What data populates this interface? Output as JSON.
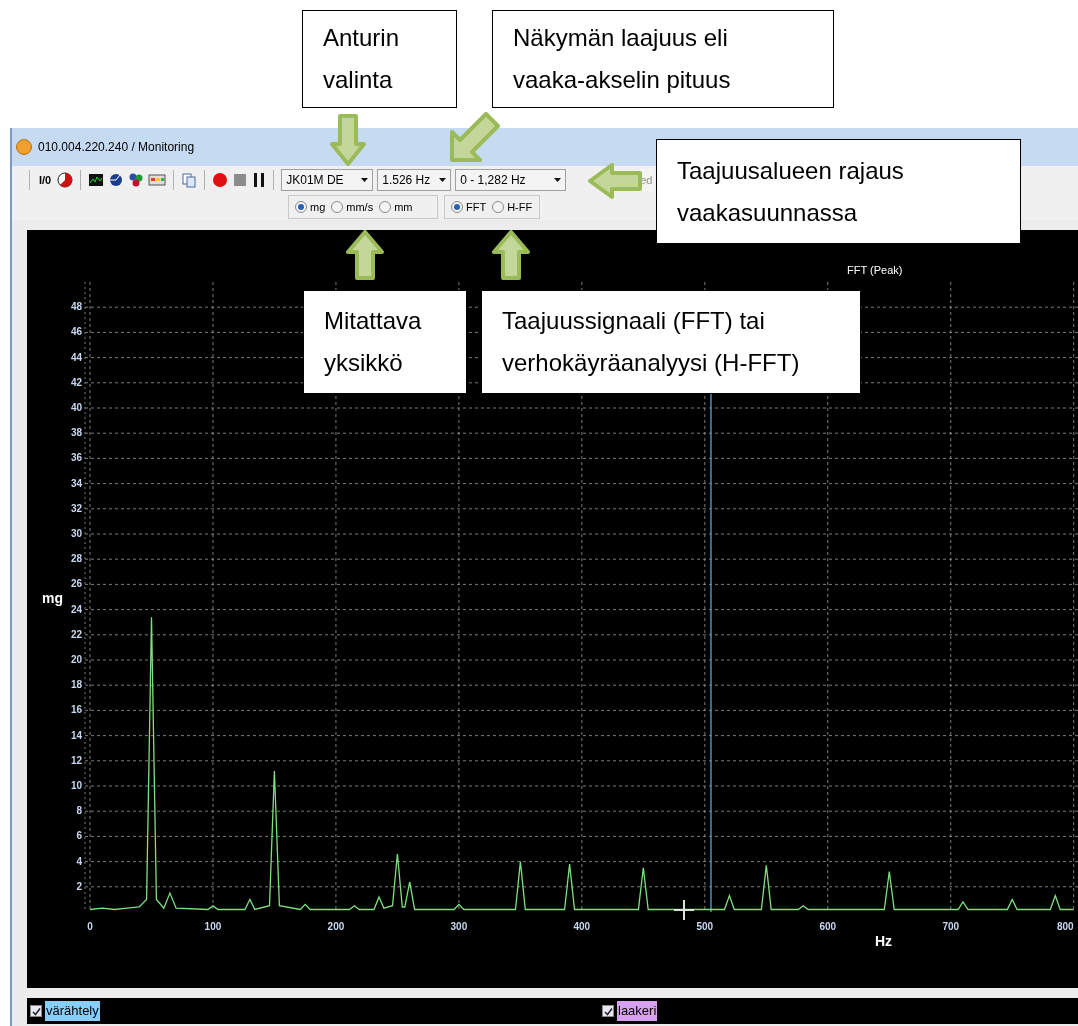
{
  "window": {
    "title": "010.004.220.240 / Monitoring"
  },
  "toolbar": {
    "io_button": "I/0",
    "sensor_dropdown": "JK01M DE",
    "resolution_dropdown": "1.526 Hz",
    "range_dropdown": "0 - 1,282 Hz",
    "partial_button": "ed"
  },
  "unit_options": [
    {
      "label": "mg",
      "selected": true
    },
    {
      "label": "mm/s",
      "selected": false
    },
    {
      "label": "mm",
      "selected": false
    }
  ],
  "mode_options": [
    {
      "label": "FFT",
      "selected": true
    },
    {
      "label": "H-FF",
      "selected": false
    }
  ],
  "chart": {
    "chart_data": {
      "type": "line",
      "title": "FFT (Peak)",
      "xlabel": "Hz",
      "ylabel": "mg",
      "xlim": [
        0,
        800
      ],
      "ylim": [
        0,
        50
      ],
      "grid": true,
      "xticks": [
        0,
        100,
        200,
        300,
        400,
        500,
        600,
        700,
        800
      ],
      "yticks": [
        2,
        4,
        6,
        8,
        10,
        12,
        14,
        16,
        18,
        20,
        22,
        24,
        26,
        28,
        30,
        32,
        34,
        36,
        38,
        40,
        42,
        44,
        46,
        48
      ],
      "x": [
        0,
        10,
        20,
        30,
        40,
        46,
        50,
        54,
        60,
        65,
        70,
        96,
        100,
        104,
        126,
        130,
        134,
        146,
        150,
        154,
        171,
        175,
        179,
        211,
        215,
        219,
        231,
        235,
        239,
        246,
        250,
        254,
        256,
        260,
        264,
        296,
        300,
        304,
        346,
        350,
        354,
        386,
        390,
        394,
        446,
        450,
        454,
        516,
        520,
        524,
        546,
        550,
        554,
        576,
        580,
        584,
        646,
        650,
        654,
        706,
        710,
        714,
        746,
        750,
        754,
        781,
        785,
        789,
        800
      ],
      "series": [
        {
          "color": "#7ee07e",
          "values": [
            0.2,
            0.3,
            0.2,
            0.3,
            0.4,
            1,
            23.4,
            1,
            0.3,
            1.5,
            0.3,
            0.2,
            0.5,
            0.2,
            0.2,
            1,
            0.2,
            0.5,
            11.2,
            0.5,
            0.2,
            0.6,
            0.2,
            0.2,
            0.5,
            0.2,
            0.2,
            1.2,
            0.3,
            0.5,
            4.6,
            0.4,
            0.4,
            2.4,
            0.2,
            0.2,
            0.6,
            0.2,
            0.2,
            4,
            0.2,
            0.2,
            3.8,
            0.2,
            0.2,
            3.5,
            0.2,
            0.2,
            1.3,
            0.2,
            0.2,
            3.7,
            0.2,
            0.2,
            0.5,
            0.2,
            0.2,
            3.2,
            0.2,
            0.2,
            0.8,
            0.2,
            0.2,
            1,
            0.2,
            0.2,
            1.3,
            0.2,
            0.2
          ]
        }
      ],
      "ref_lines": [
        {
          "axis": "x",
          "value": 505
        }
      ]
    }
  },
  "legend": [
    {
      "label": "värähtely",
      "checked": true,
      "color": "#87cefa"
    },
    {
      "label": "laakeri",
      "checked": true,
      "color": "#d8a0f0"
    }
  ],
  "callouts": [
    {
      "lines": [
        "Anturin",
        "valinta"
      ],
      "kind": "down"
    },
    {
      "lines": [
        "Näkymän laajuus eli",
        "vaaka-akselin pituus"
      ],
      "kind": "down-left"
    },
    {
      "lines": [
        "Taajuusalueen rajaus",
        "vaakasuunnassa"
      ],
      "kind": "left"
    },
    {
      "lines": [
        "Mitattava",
        "yksikkö"
      ],
      "kind": "up"
    },
    {
      "lines": [
        "Taajuussignaali (FFT) tai",
        "verhokäyräanalyysi (H-FFT)"
      ],
      "kind": "up"
    }
  ]
}
